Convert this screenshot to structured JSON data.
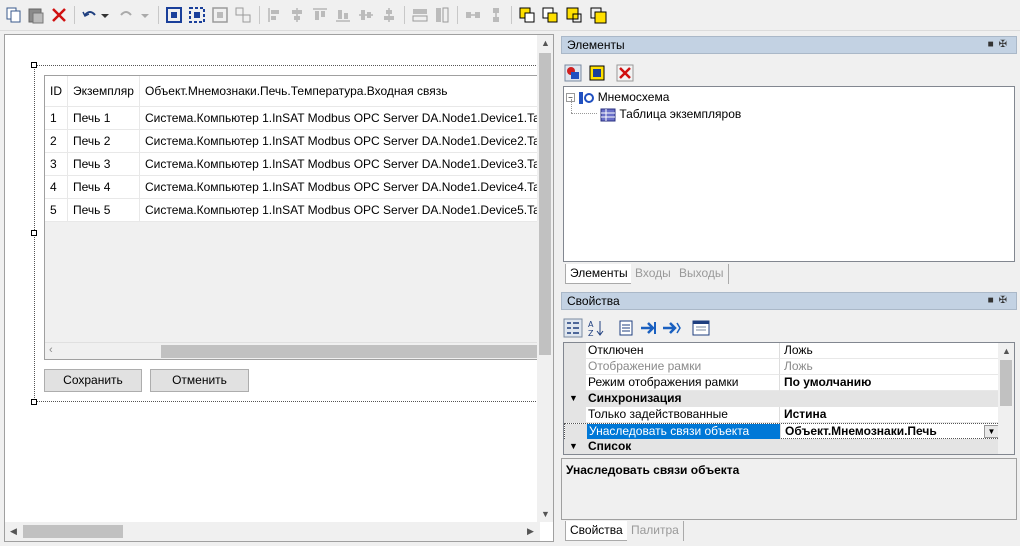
{
  "toolbar": {
    "icons": [
      "copy-icon",
      "paste-icon",
      "delete-icon",
      "undo-icon",
      "redo-icon",
      "group-icon",
      "ungroup-icon",
      "align-icon",
      "distribute-icon",
      "align-left-icon",
      "align-center-icon",
      "align-top-icon",
      "align-bottom-icon",
      "align-middle-icon",
      "same-width-icon",
      "same-height-icon",
      "size-icon",
      "space-h-icon",
      "space-v-icon",
      "bring-front-icon",
      "send-back-icon",
      "forward-icon",
      "backward-icon"
    ]
  },
  "grid": {
    "columns": [
      "ID",
      "Экземпляр",
      "Объект.Мнемознаки.Печь.Температура.Входная связь"
    ],
    "rows": [
      [
        "1",
        "Печь 1",
        "Система.Компьютер 1.InSAT Modbus OPC Server DA.Node1.Device1.Ta"
      ],
      [
        "2",
        "Печь 2",
        "Система.Компьютер 1.InSAT Modbus OPC Server DA.Node1.Device2.Ta"
      ],
      [
        "3",
        "Печь 3",
        "Система.Компьютер 1.InSAT Modbus OPC Server DA.Node1.Device3.Ta"
      ],
      [
        "4",
        "Печь 4",
        "Система.Компьютер 1.InSAT Modbus OPC Server DA.Node1.Device4.Ta"
      ],
      [
        "5",
        "Печь 5",
        "Система.Компьютер 1.InSAT Modbus OPC Server DA.Node1.Device5.Ta"
      ]
    ],
    "save_label": "Сохранить",
    "cancel_label": "Отменить"
  },
  "elements_panel": {
    "title": "Элементы",
    "tree_root": "Мнемосхема",
    "tree_child": "Таблица экземпляров",
    "tabs": [
      "Элементы",
      "Входы",
      "Выходы"
    ]
  },
  "properties_panel": {
    "title": "Свойства",
    "rows": [
      {
        "kind": "prop",
        "name": "Отключен",
        "value": "Ложь",
        "disabled": false
      },
      {
        "kind": "prop",
        "name": "Отображение рамки",
        "value": "Ложь",
        "disabled": true
      },
      {
        "kind": "prop",
        "name": "Режим отображения рамки",
        "value": "По умолчанию",
        "bold": true
      },
      {
        "kind": "cat",
        "name": "Синхронизация"
      },
      {
        "kind": "prop",
        "name": "Только задействованные",
        "value": "Истина",
        "bold": true
      },
      {
        "kind": "prop",
        "name": "Унаследовать связи объекта",
        "value": "Объект.Мнемознаки.Печь",
        "bold": true,
        "selected": true
      },
      {
        "kind": "cat",
        "name": "Список"
      }
    ],
    "description": "Унаследовать связи объекта",
    "tabs": [
      "Свойства",
      "Палитра"
    ]
  },
  "colors": {
    "panel_title_bg": "#c3d2e3",
    "selection": "#0078d7"
  }
}
